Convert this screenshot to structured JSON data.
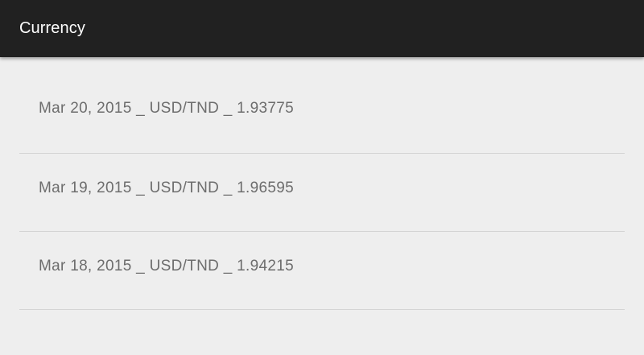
{
  "app_bar": {
    "title": "Currency",
    "background": "#212121"
  },
  "rates": [
    {
      "text": "Mar 20, 2015 _ USD/TND _ 1.93775"
    },
    {
      "text": "Mar 19, 2015 _ USD/TND _ 1.96595"
    },
    {
      "text": "Mar 18, 2015 _ USD/TND _ 1.94215"
    }
  ]
}
